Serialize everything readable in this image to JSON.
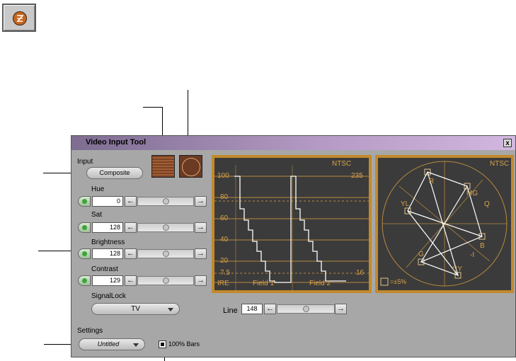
{
  "window": {
    "title": "Video Input Tool",
    "close": "x"
  },
  "input": {
    "label": "Input",
    "value": "Composite"
  },
  "sliders": [
    {
      "label": "Hue",
      "value": "0",
      "level": 0.5
    },
    {
      "label": "Sat",
      "value": "128",
      "level": 0.5
    },
    {
      "label": "Brightness",
      "value": "128",
      "level": 0.5
    },
    {
      "label": "Contrast",
      "value": "129",
      "level": 0.5
    }
  ],
  "signallock": {
    "label": "SignalLock",
    "value": "TV"
  },
  "settings": {
    "label": "Settings",
    "value": "Untitled"
  },
  "bars": {
    "label": "100% Bars",
    "checked": true
  },
  "waveform": {
    "standard": "NTSC",
    "marks_left": [
      "100",
      "80",
      "60",
      "40",
      "20",
      "7.5"
    ],
    "mark_right_top": "235",
    "mark_right_bottom": "16",
    "unit": "IRE",
    "field1": "Field 1",
    "field2": "Field 2"
  },
  "vectorscope": {
    "standard": "NTSC",
    "targets": [
      "R",
      "MG",
      "YL",
      "Q",
      "B",
      "-I",
      "G",
      "CY"
    ],
    "tolerance": "=±5%"
  },
  "line": {
    "label": "Line",
    "value": "148",
    "level": 0.5
  },
  "colors": {
    "scope_border": "#c28a2c",
    "scope_bg": "#3b3b3b",
    "title_start": "#7e6d91",
    "title_end": "#d2b8e0"
  }
}
